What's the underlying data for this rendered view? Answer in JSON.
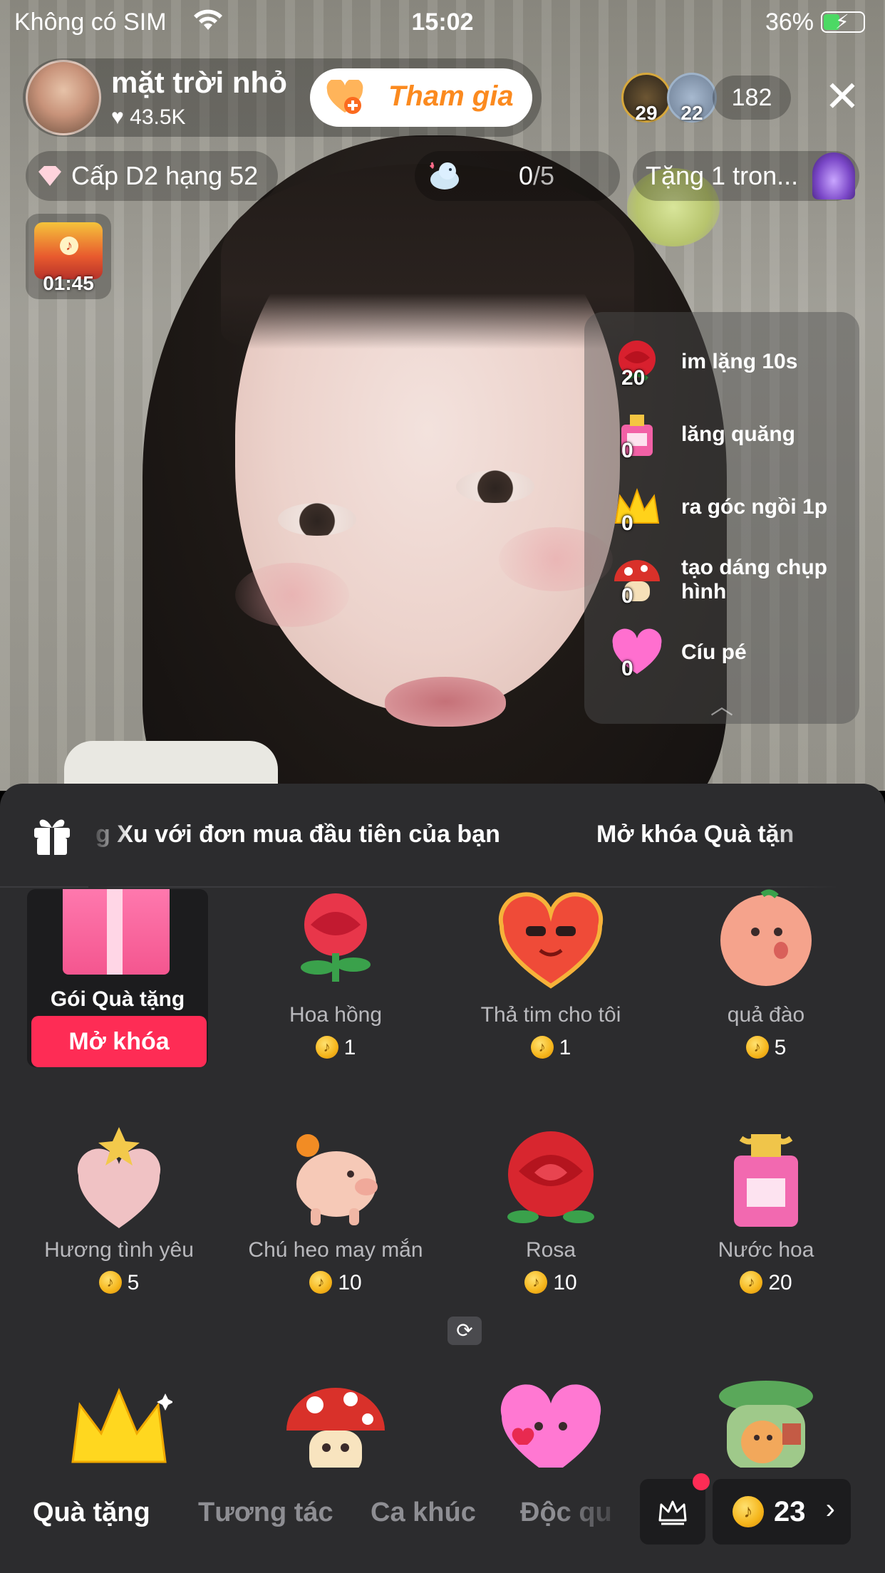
{
  "status_bar": {
    "carrier": "Không có SIM",
    "time": "15:02",
    "battery": "36%"
  },
  "host": {
    "name": "mặt trời nhỏ",
    "likes": "43.5K",
    "join_label": "Tham gia"
  },
  "viewers": {
    "top1_num": "29",
    "top2_num": "22",
    "count": "182"
  },
  "chips": {
    "rank": "Cấp D2 hạng 52",
    "goal_progress": "0",
    "goal_total": "/5",
    "gift_promo": "Tặng 1 tron..."
  },
  "treasure": {
    "timer": "01:45"
  },
  "wish_list": [
    {
      "count": "20",
      "label": "im lặng 10s",
      "icon": "rose-icon"
    },
    {
      "count": "0",
      "label": "lăng quăng",
      "icon": "perfume-icon"
    },
    {
      "count": "0",
      "label": "ra góc ngồi 1p",
      "icon": "crown-icon"
    },
    {
      "count": "0",
      "label": "tạo dáng chụp hình",
      "icon": "mushroom-icon"
    },
    {
      "count": "0",
      "label": "Cíu pé",
      "icon": "heart-icon"
    }
  ],
  "banner": {
    "message": "g Xu với đơn mua đầu tiên của bạn",
    "message2": "Mở khóa Quà tặn"
  },
  "unlock_card": {
    "title": "Gói Quà tặng",
    "button": "Mở khóa"
  },
  "gifts": [
    {
      "name": "Hoa hồng",
      "price": "1"
    },
    {
      "name": "Thả tim cho tôi",
      "price": "1"
    },
    {
      "name": "quả đào",
      "price": "5"
    },
    {
      "name": "Hương tình yêu",
      "price": "5"
    },
    {
      "name": "Chú heo may mắn",
      "price": "10"
    },
    {
      "name": "Rosa",
      "price": "10"
    },
    {
      "name": "Nước hoa",
      "price": "20"
    }
  ],
  "tabs": {
    "gifts": "Quà tặng",
    "interact": "Tương tác",
    "songs": "Ca khúc",
    "exclusive": "Độc qu"
  },
  "balance": "23",
  "colors": {
    "accent_red": "#fe2c55",
    "join_orange": "#fb8a1f",
    "sheet_bg": "#2c2c2e",
    "coin_gold": "#f5b51b"
  }
}
